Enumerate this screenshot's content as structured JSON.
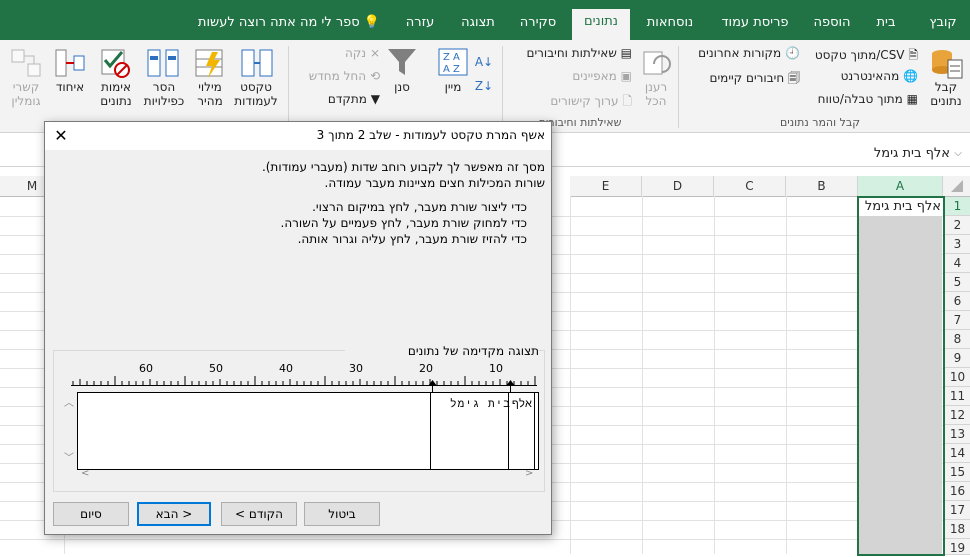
{
  "tabs": [
    {
      "label": "קובץ",
      "active": false
    },
    {
      "label": "בית",
      "active": false
    },
    {
      "label": "הוספה",
      "active": false
    },
    {
      "label": "פריסת עמוד",
      "active": false
    },
    {
      "label": "נוסחאות",
      "active": false
    },
    {
      "label": "נתונים",
      "active": true
    },
    {
      "label": "סקירה",
      "active": false
    },
    {
      "label": "תצוגה",
      "active": false
    },
    {
      "label": "עזרה",
      "active": false
    }
  ],
  "tell_me": "ספר לי מה אתה רוצה לעשות",
  "ribbon": {
    "get_data": {
      "label1": "קבל",
      "label2": "נתונים"
    },
    "from_text_csv": "מתוך טקסט/CSV",
    "from_web": "מהאינטרנט",
    "from_table": "מתוך טבלה/טווח",
    "recent_sources": "מקורות אחרונים",
    "existing_connections": "חיבורים קיימים",
    "group_get_transform": "קבל והמר נתונים",
    "refresh_all": {
      "label1": "רענן",
      "label2": "הכל"
    },
    "queries_connections": "שאילתות וחיבורים",
    "properties": "מאפיינים",
    "edit_links": "ערוך קישורים",
    "group_queries": "שאילתות וחיבורים",
    "sort": "מיין",
    "filter": "סנן",
    "clear": "נקה",
    "reapply": "החל מחדש",
    "advanced": "מתקדם",
    "text_to_columns": {
      "label1": "טקסט",
      "label2": "לעמודות"
    },
    "flash_fill": {
      "label1": "מילוי",
      "label2": "מהיר"
    },
    "remove_duplicates": {
      "label1": "הסר",
      "label2": "כפילויות"
    },
    "data_validation": {
      "label1": "אימות",
      "label2": "נתונים"
    },
    "consolidate": "איחוד",
    "relationships": {
      "label1": "קשרי",
      "label2": "גומלין"
    }
  },
  "formula_bar": {
    "value": "אלף בית גימל"
  },
  "grid": {
    "columns": [
      "A",
      "B",
      "C",
      "D",
      "E",
      "M"
    ],
    "rows": [
      "1",
      "2",
      "3",
      "4",
      "5",
      "6",
      "7",
      "8",
      "9",
      "10",
      "11",
      "12",
      "13",
      "14",
      "15",
      "16",
      "17",
      "18",
      "19"
    ],
    "cell_A1": "אלף בית גימל"
  },
  "dialog": {
    "title": "אשף המרת טקסט לעמודות - שלב 2 מתוך 3",
    "intro_line1": "מסך זה מאפשר לך לקבוע רוחב שדות (מעברי עמודות).",
    "intro_line2": "שורות המכילות חצים מציינות מעבר עמודה.",
    "instr_line1": "כדי ליצור שורת מעבר, לחץ במיקום הרצוי.",
    "instr_line2": "כדי למחוק שורת מעבר, לחץ פעמיים על השורה.",
    "instr_line3": "כדי להזיז שורת מעבר, לחץ עליה וגרור אותה.",
    "preview_label": "תצוגה מקדימה של נתונים",
    "ruler_numbers": [
      "10",
      "20",
      "30",
      "40",
      "50",
      "60"
    ],
    "preview_text_part1": "אלף",
    "preview_text_part2": "בית גימל",
    "buttons": {
      "cancel": "ביטול",
      "back": "< הקודם",
      "next": "הבא >",
      "finish": "סיום"
    }
  },
  "colors": {
    "excel_green": "#217346",
    "selected_header": "#d3f0e0",
    "dialog_bg": "#f0f0f0",
    "default_button_border": "#0078d7"
  }
}
